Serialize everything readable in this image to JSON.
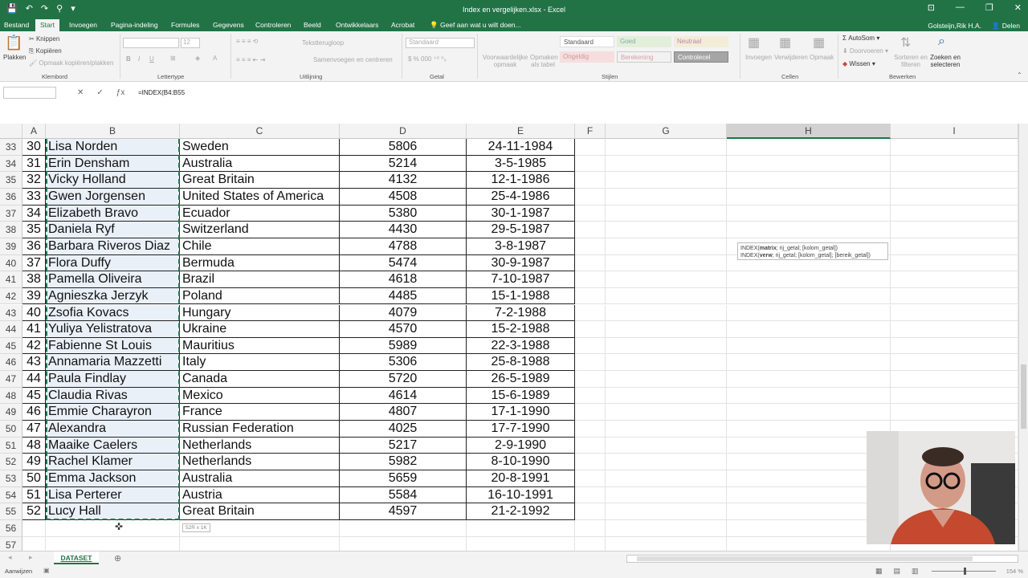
{
  "titlebar": {
    "title": "Index en vergelijken.xlsx - Excel",
    "qat": [
      "💾",
      "↶",
      "↷",
      "⚲",
      "▾"
    ],
    "winbtns": [
      "⊡",
      "—",
      "❐",
      "✕"
    ]
  },
  "tabs": {
    "file": "Bestand",
    "items": [
      "Start",
      "Invoegen",
      "Pagina-indeling",
      "Formules",
      "Gegevens",
      "Controleren",
      "Beeld",
      "Ontwikkelaars",
      "Acrobat"
    ],
    "tell_me": "Geef aan wat u wilt doen...",
    "user": "Golsteijn,Rik H.A.",
    "share": "Delen"
  },
  "ribbon": {
    "clipboard": {
      "paste": "Plakken",
      "cut": "Knippen",
      "copy": "Kopiëren",
      "format_painter": "Opmaak kopiëren/plakken",
      "label": "Klembord"
    },
    "font": {
      "size": "12",
      "label": "Lettertype",
      "bold": "B",
      "italic": "I",
      "underline": "U"
    },
    "alignment": {
      "wrap": "Tekstterugloop",
      "merge": "Samenvoegen en centreren",
      "label": "Uitlijning"
    },
    "number": {
      "format": "Standaard",
      "label": "Getal"
    },
    "styles": {
      "conditional": "Voorwaardelijke opmaak",
      "table": "Opmaken als tabel",
      "cells": [
        "Standaard",
        "Goed",
        "Neutraal",
        "Ongeldig",
        "Berekening",
        "Controlecel"
      ],
      "label": "Stijlen"
    },
    "cells": {
      "insert": "Invoegen",
      "delete": "Verwijderen",
      "format": "Opmaak",
      "label": "Cellen"
    },
    "editing": {
      "autosum": "AutoSom",
      "fill": "Doorvoeren",
      "clear": "Wissen",
      "sort": "Sorteren en filteren",
      "find": "Zoeken en selecteren",
      "label": "Bewerken"
    }
  },
  "formula_bar": {
    "name_box": "",
    "formula": "=INDEX(B4:B55"
  },
  "columns": [
    "A",
    "B",
    "C",
    "D",
    "E",
    "F",
    "G",
    "H",
    "I"
  ],
  "rows": [
    {
      "r": "33",
      "a": "30",
      "b": "Lisa Norden",
      "c": "Sweden",
      "d": "5806",
      "e": "24-11-1984"
    },
    {
      "r": "34",
      "a": "31",
      "b": "Erin Densham",
      "c": "Australia",
      "d": "5214",
      "e": "3-5-1985"
    },
    {
      "r": "35",
      "a": "32",
      "b": "Vicky Holland",
      "c": "Great Britain",
      "d": "4132",
      "e": "12-1-1986"
    },
    {
      "r": "36",
      "a": "33",
      "b": "Gwen Jorgensen",
      "c": "United States of America",
      "d": "4508",
      "e": "25-4-1986"
    },
    {
      "r": "37",
      "a": "34",
      "b": "Elizabeth Bravo",
      "c": "Ecuador",
      "d": "5380",
      "e": "30-1-1987"
    },
    {
      "r": "38",
      "a": "35",
      "b": "Daniela Ryf",
      "c": "Switzerland",
      "d": "4430",
      "e": "29-5-1987"
    },
    {
      "r": "39",
      "a": "36",
      "b": "Barbara Riveros Diaz",
      "c": "Chile",
      "d": "4788",
      "e": "3-8-1987"
    },
    {
      "r": "40",
      "a": "37",
      "b": "Flora Duffy",
      "c": "Bermuda",
      "d": "5474",
      "e": "30-9-1987"
    },
    {
      "r": "41",
      "a": "38",
      "b": "Pamella Oliveira",
      "c": "Brazil",
      "d": "4618",
      "e": "7-10-1987"
    },
    {
      "r": "42",
      "a": "39",
      "b": "Agnieszka Jerzyk",
      "c": "Poland",
      "d": "4485",
      "e": "15-1-1988"
    },
    {
      "r": "43",
      "a": "40",
      "b": "Zsofia Kovacs",
      "c": "Hungary",
      "d": "4079",
      "e": "7-2-1988"
    },
    {
      "r": "44",
      "a": "41",
      "b": "Yuliya Yelistratova",
      "c": "Ukraine",
      "d": "4570",
      "e": "15-2-1988"
    },
    {
      "r": "45",
      "a": "42",
      "b": "Fabienne St Louis",
      "c": "Mauritius",
      "d": "5989",
      "e": "22-3-1988"
    },
    {
      "r": "46",
      "a": "43",
      "b": "Annamaria Mazzetti",
      "c": "Italy",
      "d": "5306",
      "e": "25-8-1988"
    },
    {
      "r": "47",
      "a": "44",
      "b": "Paula Findlay",
      "c": "Canada",
      "d": "5720",
      "e": "26-5-1989"
    },
    {
      "r": "48",
      "a": "45",
      "b": "Claudia Rivas",
      "c": "Mexico",
      "d": "4614",
      "e": "15-6-1989"
    },
    {
      "r": "49",
      "a": "46",
      "b": "Emmie Charayron",
      "c": "France",
      "d": "4807",
      "e": "17-1-1990"
    },
    {
      "r": "50",
      "a": "47",
      "b": "Alexandra",
      "c": "Russian Federation",
      "d": "4025",
      "e": "17-7-1990"
    },
    {
      "r": "51",
      "a": "48",
      "b": "Maaike Caelers",
      "c": "Netherlands",
      "d": "5217",
      "e": "2-9-1990"
    },
    {
      "r": "52",
      "a": "49",
      "b": "Rachel Klamer",
      "c": "Netherlands",
      "d": "5982",
      "e": "8-10-1990"
    },
    {
      "r": "53",
      "a": "50",
      "b": "Emma Jackson",
      "c": "Australia",
      "d": "5659",
      "e": "20-8-1991"
    },
    {
      "r": "54",
      "a": "51",
      "b": "Lisa Perterer",
      "c": "Austria",
      "d": "5584",
      "e": "16-10-1991"
    },
    {
      "r": "55",
      "a": "52",
      "b": "Lucy Hall",
      "c": "Great Britain",
      "d": "4597",
      "e": "21-2-1992"
    },
    {
      "r": "56",
      "a": "",
      "b": "",
      "c": "",
      "d": "",
      "e": ""
    },
    {
      "r": "57",
      "a": "",
      "b": "",
      "c": "",
      "d": "",
      "e": ""
    }
  ],
  "tooltip": {
    "line1_pre": "INDEX(",
    "line1_bold": "matrix",
    "line1_post": "; rij_getal; [kolom_getal])",
    "line2_pre": "INDEX(",
    "line2_bold": "verw",
    "line2_post": "; rij_getal; [kolom_getal]; [bereik_getal])"
  },
  "size_hint": "52R x 1K",
  "sheet_tab": "DATASET",
  "status": {
    "mode": "Aanwijzen",
    "zoom": "154 %"
  }
}
